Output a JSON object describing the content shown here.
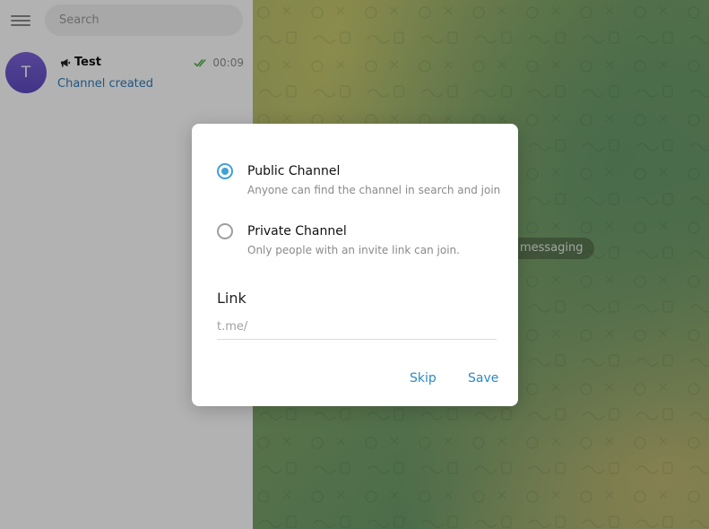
{
  "sidebar": {
    "search_placeholder": "Search",
    "chats": [
      {
        "avatar_letter": "T",
        "title": "Test",
        "time": "00:09",
        "preview": "Channel created",
        "icon": "megaphone-icon",
        "status_icon": "double-check-icon"
      }
    ]
  },
  "chat": {
    "service_text": "messaging"
  },
  "dialog": {
    "options": [
      {
        "label": "Public Channel",
        "description": "Anyone can find the channel in search and join",
        "checked": true
      },
      {
        "label": "Private Channel",
        "description": "Only people with an invite link can join.",
        "checked": false
      }
    ],
    "link_label": "Link",
    "link_placeholder": "t.me/",
    "skip_label": "Skip",
    "save_label": "Save"
  },
  "colors": {
    "accent": "#419fd9",
    "button_text": "#2b8ac7",
    "preview_text": "#2f7bbd",
    "avatar": "#6f58d0"
  }
}
